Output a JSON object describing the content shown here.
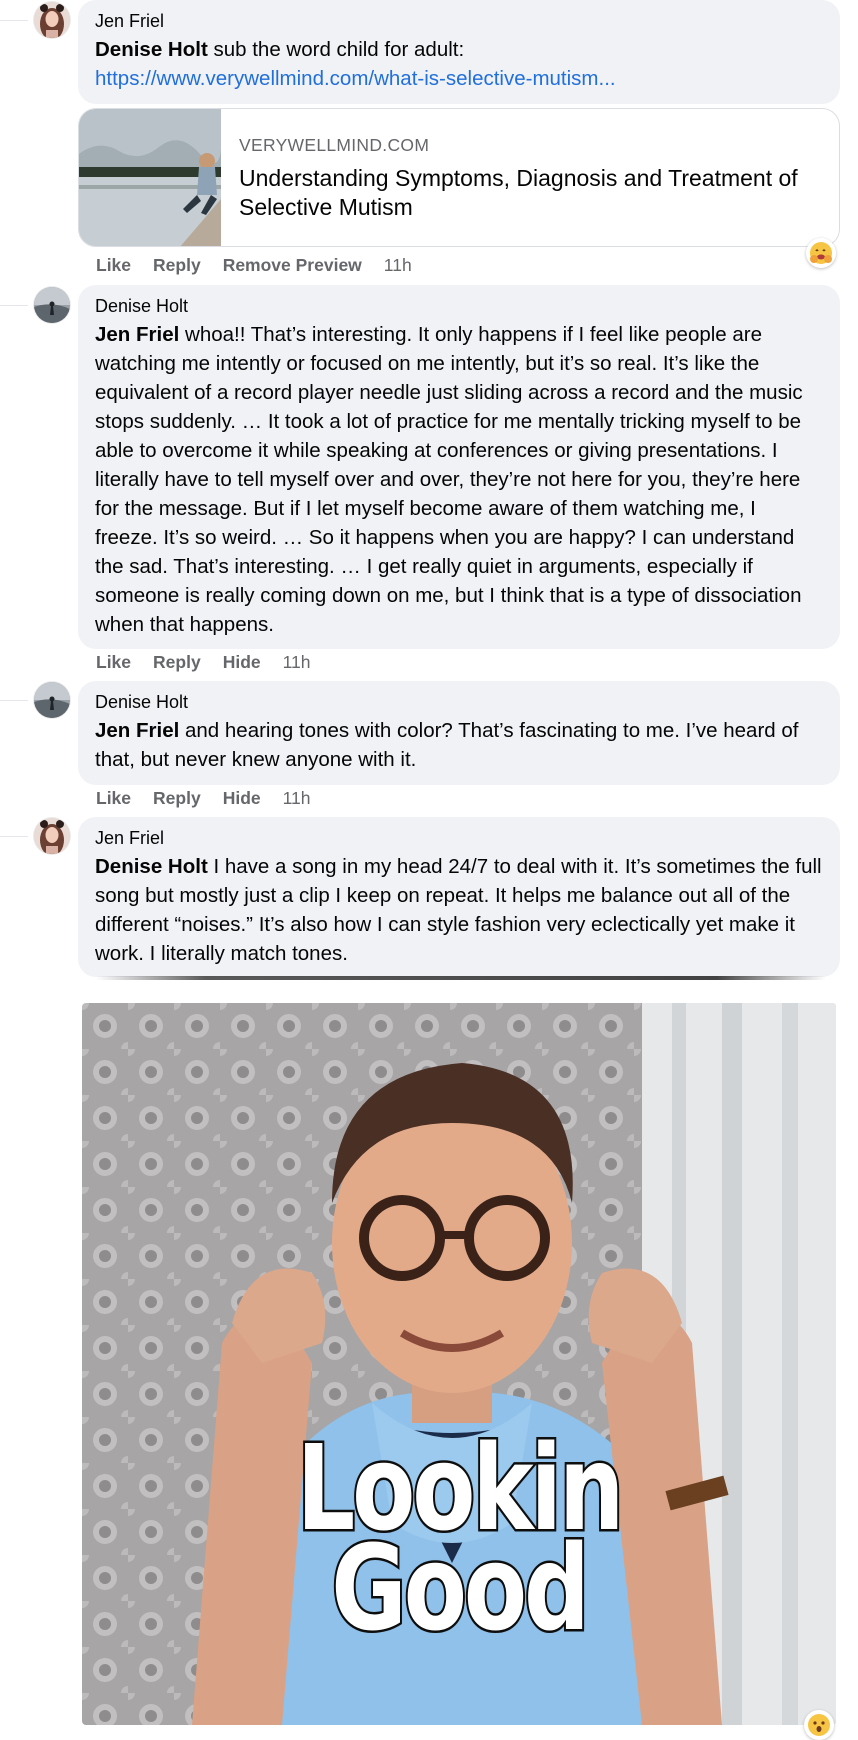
{
  "comments": [
    {
      "author": "Jen Friel",
      "mention": "Denise Holt",
      "text": " sub the word child for adult:",
      "link": "https://www.verywellmind.com/what-is-selective-mutism...",
      "preview": {
        "domain": "VERYWELLMIND.COM",
        "title": "Understanding Symptoms, Diagnosis and Treatment of Selective Mutism"
      },
      "actions": [
        "Like",
        "Reply",
        "Remove Preview"
      ],
      "time": "11h",
      "reaction_icon": "hug-emoji-icon"
    },
    {
      "author": "Denise Holt",
      "mention": "Jen Friel",
      "text": " whoa!! That’s interesting. It only happens if I feel like people are watching me intently or focused on me intently, but it’s so real. It’s like the equivalent of a record player needle just sliding across a record and the music stops suddenly. … It took a lot of practice for me mentally tricking myself to be able to overcome it while speaking at conferences or giving presentations. I literally have to tell myself over and over, they’re not here for you, they’re here for the message. But if I let myself become aware of them watching me, I freeze. It’s so weird. … So it happens when you are happy? I can understand the sad. That’s interesting. … I get really quiet in arguments, especially if someone is really coming down on me, but I think that is a type of dissociation when that happens.",
      "actions": [
        "Like",
        "Reply",
        "Hide"
      ],
      "time": "11h"
    },
    {
      "author": "Denise Holt",
      "mention": "Jen Friel",
      "text": " and hearing tones with color? That’s fascinating to me. I’ve heard of that, but never knew anyone with it.",
      "actions": [
        "Like",
        "Reply",
        "Hide"
      ],
      "time": "11h"
    },
    {
      "author": "Jen Friel",
      "mention": "Denise Holt",
      "text": " I have a song in my head 24/7 to deal with it. It’s sometimes the full song but mostly just a clip I keep on repeat. It helps me balance out all of the different “noises.” It’s also how I can style fashion very eclectically yet make it work. I literally match tones.",
      "gif_caption_line1": "Lookin",
      "gif_caption_line2": "Good",
      "reaction_icon": "surprised-emoji-icon"
    }
  ]
}
